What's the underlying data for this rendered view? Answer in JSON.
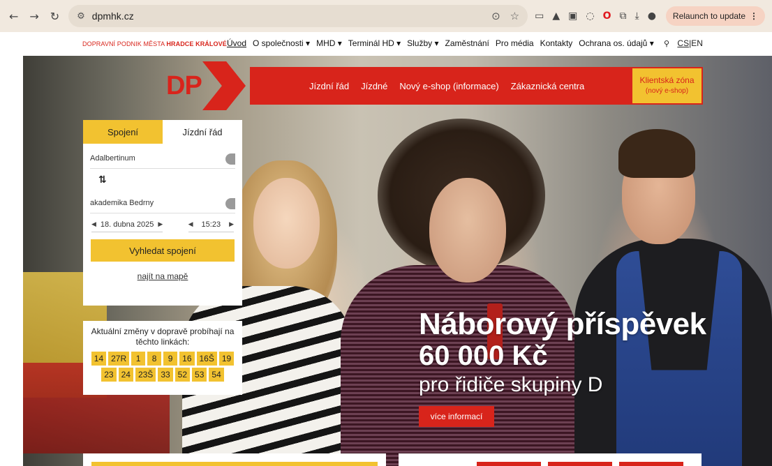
{
  "browser": {
    "back": "←",
    "forward": "→",
    "reload": "↻",
    "url": "dpmhk.cz",
    "relaunch_label": "Relaunch to update",
    "menu": "⋮"
  },
  "site_top": {
    "brand_prefix": "DOPRAVNÍ PODNIK MĚSTA ",
    "brand_bold": "HRADCE KRÁLOVÉ",
    "menu": [
      {
        "label": "Úvod",
        "active": true
      },
      {
        "label": "O společnosti ▾"
      },
      {
        "label": "MHD ▾"
      },
      {
        "label": "Terminál HD ▾"
      },
      {
        "label": "Služby ▾"
      },
      {
        "label": "Zaměstnání"
      },
      {
        "label": "Pro média"
      },
      {
        "label": "Kontakty"
      },
      {
        "label": "Ochrana os. údajů ▾"
      }
    ],
    "lang_cs": "CS",
    "lang_sep": "|",
    "lang_en": "EN"
  },
  "logo": {
    "text": "DP"
  },
  "red_menu": {
    "items": [
      "Jízdní řád",
      "Jízdné",
      "Nový e-shop (informace)",
      "Zákaznická centra"
    ],
    "client_zone_title": "Klientská zóna",
    "client_zone_sub": "(nový e-shop)"
  },
  "widget": {
    "tab_connection": "Spojení",
    "tab_timetable": "Jízdní řád",
    "from": "Adalbertinum",
    "swap": "⇅",
    "to": "akademika Bedrny",
    "date": "18. dubna 2025",
    "time": "15:23",
    "search_button": "Vyhledat spojení",
    "map_link": "najít na mapě"
  },
  "changes": {
    "text": "Aktuální změny v dopravě probíhají na těchto linkách:",
    "lines": [
      "14",
      "27R",
      "1",
      "8",
      "9",
      "16",
      "16Š",
      "19",
      "23",
      "24",
      "23Š",
      "33",
      "52",
      "53",
      "54"
    ]
  },
  "headline": {
    "line1": "Náborový příspěvek",
    "line2": "60 000 Kč",
    "line3": "pro řidiče skupiny D",
    "button": "více informací"
  },
  "colors": {
    "brand_red": "#d8241b",
    "brand_yellow": "#f2c230"
  }
}
